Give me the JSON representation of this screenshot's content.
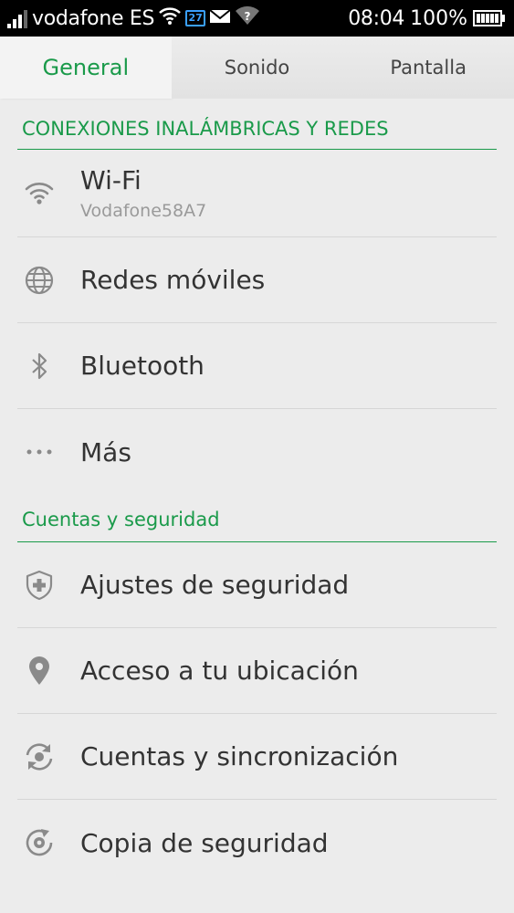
{
  "status_bar": {
    "carrier": "vodafone ES",
    "calendar_day": "27",
    "time": "08:04",
    "battery": "100%",
    "icons": [
      "signal-icon",
      "wifi-icon",
      "calendar-icon",
      "mail-icon",
      "wifi-question-icon",
      "battery-icon"
    ]
  },
  "tabs": [
    {
      "label": "General",
      "active": true
    },
    {
      "label": "Sonido",
      "active": false
    },
    {
      "label": "Pantalla",
      "active": false
    }
  ],
  "sections": [
    {
      "title": "CONEXIONES INALÁMBRICAS Y REDES",
      "items": [
        {
          "label": "Wi-Fi",
          "sublabel": "Vodafone58A7",
          "icon": "wifi-icon"
        },
        {
          "label": "Redes móviles",
          "icon": "globe-icon"
        },
        {
          "label": "Bluetooth",
          "icon": "bluetooth-icon"
        },
        {
          "label": "Más",
          "icon": "more-icon"
        }
      ]
    },
    {
      "title": "Cuentas y seguridad",
      "items": [
        {
          "label": "Ajustes de seguridad",
          "icon": "shield-icon"
        },
        {
          "label": "Acceso a tu ubicación",
          "icon": "location-pin-icon"
        },
        {
          "label": "Cuentas y sincronización",
          "icon": "sync-icon"
        },
        {
          "label": "Copia de seguridad",
          "icon": "backup-icon"
        }
      ]
    }
  ],
  "colors": {
    "accent": "#1a9a4a",
    "background": "#ececec",
    "status_bar": "#000000"
  }
}
